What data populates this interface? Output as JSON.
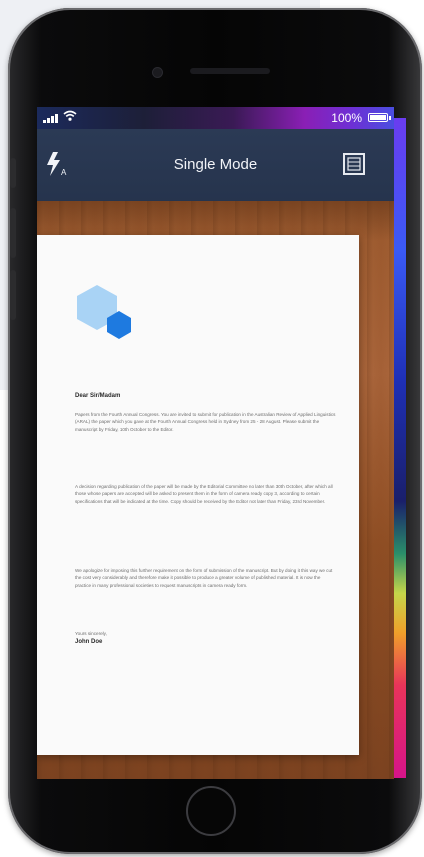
{
  "status_bar": {
    "battery_label": "100%",
    "battery_level": 1.0,
    "wifi_icon": "wifi-icon",
    "signal_icon": "cellular-signal-icon"
  },
  "toolbar": {
    "title": "Single Mode",
    "left_icon": "flash-auto-icon",
    "right_icon": "gallery-icon"
  },
  "document": {
    "greeting": "Dear Sir/Madam",
    "paragraph_1": "Papers from the Fourth Annual Congress. You are invited to submit for publication in the Australian Review of Applied Linguistics (ARAL) the paper which you gave at the Fourth Annual Congress held in Sydney from 25 - 28 August. Please submit the manuscript by Friday, 10th October to the Editor.",
    "paragraph_2": "A decision regarding publication of the paper will be made by the Editorial Committee no later than 30th October, after which all those whose papers are accepted will be asked to present them in the form of camera ready copy 3, according to certain specifications that will be indicated at the time. Copy should be received by the Editor not later than Friday, 23rd November.",
    "paragraph_3": "We apologize for imposing this further requirement on the form of submission of the manuscript. But by doing it this way we cut the cost very considerably and therefore make it possible to produce a greater volume of published material. It is now the practice in many professional societies to request manuscripts in camera ready form.",
    "closing": "Yours sincerely,",
    "signature": "John Doe",
    "logo_icon": "hexagon-logo-icon"
  },
  "colors": {
    "toolbar_bg": "#2b3a55",
    "logo_light": "#a9d3f5",
    "logo_dark": "#1e7ae0",
    "wood": "#9b5a2e"
  }
}
